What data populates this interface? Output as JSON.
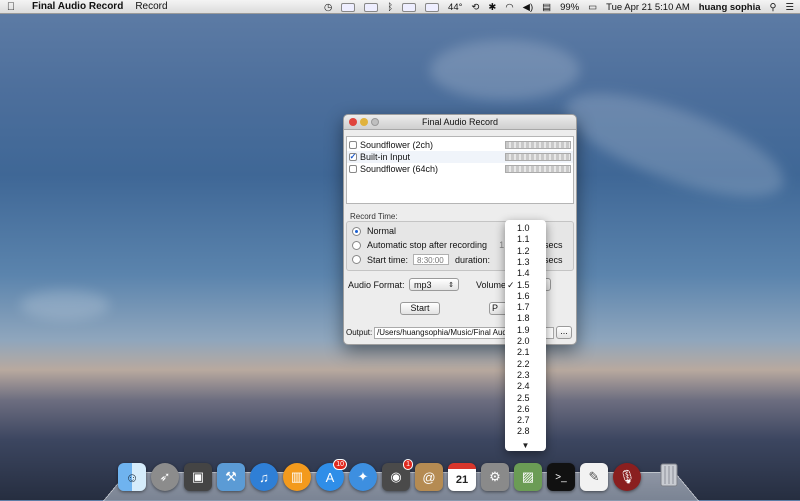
{
  "menubar": {
    "app_name": "Final Audio Record",
    "menu_item": "Record",
    "temperature": "44°",
    "battery": "99%",
    "datetime": "Tue Apr 21  5:10 AM",
    "user": "huang sophia"
  },
  "window": {
    "title": "Final Audio Record",
    "devices": [
      {
        "label": "Soundflower (2ch)",
        "checked": false
      },
      {
        "label": "Built-in Input",
        "checked": true
      },
      {
        "label": "Soundflower (64ch)",
        "checked": false
      }
    ],
    "record_time_label": "Record Time:",
    "options": {
      "normal": "Normal",
      "auto_stop": "Automatic stop after recording",
      "auto_stop_value": "1",
      "auto_stop_unit": "secs",
      "start_time": "Start time:",
      "start_time_value": "8:30:00",
      "duration": "duration:",
      "duration_unit": "secs"
    },
    "audio_format_label": "Audio Format:",
    "audio_format_value": "mp3",
    "volume_label": "Volume",
    "start_button": "Start",
    "pause_button": "P",
    "output_label": "Output:",
    "output_path": "/Users/huangsophia/Music/Final Audio",
    "browse_button": "..."
  },
  "volume_menu": {
    "selected": "1.5",
    "options": [
      "1.0",
      "1.1",
      "1.2",
      "1.3",
      "1.4",
      "1.5",
      "1.6",
      "1.7",
      "1.8",
      "1.9",
      "2.0",
      "2.1",
      "2.2",
      "2.3",
      "2.4",
      "2.5",
      "2.6",
      "2.7",
      "2.8"
    ],
    "check_mark": "✓",
    "scroll_arrow": "▼"
  },
  "dock": {
    "icons": [
      "finder-icon",
      "launchpad-icon",
      "photo-booth-icon",
      "xcode-icon",
      "itunes-icon",
      "ibooks-icon",
      "app-store-icon",
      "safari-icon",
      "facetime-icon",
      "contacts-icon",
      "calendar-icon",
      "system-preferences-icon",
      "preview-icon",
      "terminal-icon",
      "textedit-icon",
      "audio-record-icon",
      "trash-icon"
    ],
    "calendar_day": "21",
    "app_store_badge": "10",
    "facetime_badge": "1"
  }
}
